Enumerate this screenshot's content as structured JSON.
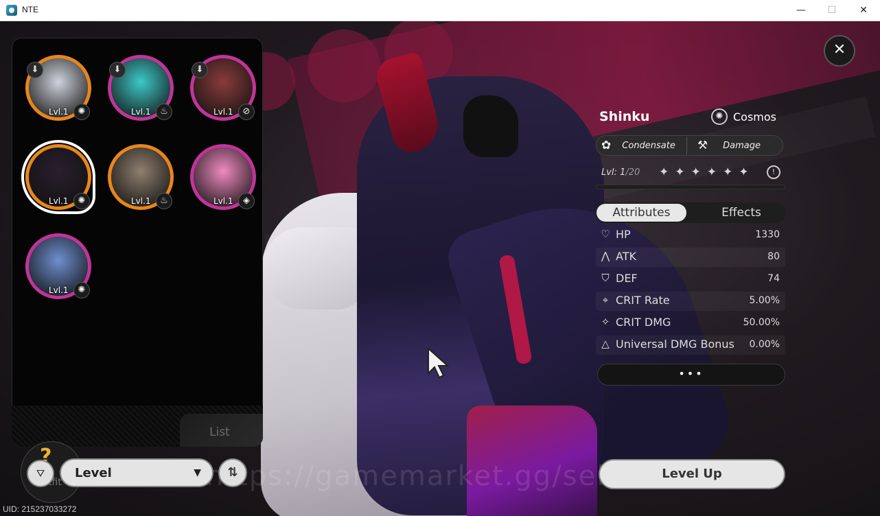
{
  "window": {
    "title": "NTE",
    "minimize_glyph": "—",
    "maximize_glyph": "☐",
    "close_glyph": "✕"
  },
  "watermark": "https://gamemarket.gg/seller/GameNe",
  "roster": {
    "tab_label": "List",
    "characters": [
      {
        "level": "Lvl.1",
        "ring_color": "#e8861c",
        "face_color": "#cfd3dc",
        "element_icon": "cosmos-icon",
        "element_glyph": "✺",
        "downloadable": true
      },
      {
        "level": "Lvl.1",
        "ring_color": "#c1349a",
        "face_color": "#3ec8c8",
        "element_icon": "anima-icon",
        "element_glyph": "♨",
        "downloadable": true
      },
      {
        "level": "Lvl.1",
        "ring_color": "#c1349a",
        "face_color": "#8a3b3b",
        "element_icon": "incantation-icon",
        "element_glyph": "⊘",
        "downloadable": true
      },
      {
        "level": "Lvl.1",
        "ring_color": "#e8861c",
        "face_color": "#2a1f2e",
        "element_icon": "cosmos-icon",
        "element_glyph": "✺",
        "downloadable": false,
        "selected": true
      },
      {
        "level": "Lvl.1",
        "ring_color": "#e8861c",
        "face_color": "#8f7f6e",
        "element_icon": "anima-icon",
        "element_glyph": "♨",
        "downloadable": false
      },
      {
        "level": "Lvl.1",
        "ring_color": "#c1349a",
        "face_color": "#f08ac0",
        "element_icon": "psyche-icon",
        "element_glyph": "◈",
        "downloadable": false
      },
      {
        "level": "Lvl.1",
        "ring_color": "#c1349a",
        "face_color": "#6f8fd0",
        "element_icon": "cosmos-icon",
        "element_glyph": "✺",
        "downloadable": false
      }
    ]
  },
  "close_button_glyph": "✕",
  "character": {
    "name": "Shinku",
    "faction": "Cosmos",
    "faction_glyph": "✺",
    "role_type": "Condensate",
    "role_type_glyph": "✿",
    "role_style": "Damage",
    "role_style_glyph": "⚒",
    "level_label": "Lvl: 1",
    "level_max": "/20",
    "stars": [
      "✦",
      "✦",
      "✦",
      "✦",
      "✦",
      "✦"
    ],
    "ascend_glyph": "!",
    "xp_progress": 0.0
  },
  "tabs": {
    "attributes": "Attributes",
    "effects": "Effects"
  },
  "stats": [
    {
      "icon": "heart-icon",
      "glyph": "♡",
      "label": "HP",
      "value": "1330"
    },
    {
      "icon": "atk-icon",
      "glyph": "⋀",
      "label": "ATK",
      "value": "80"
    },
    {
      "icon": "shield-icon",
      "glyph": "⛉",
      "label": "DEF",
      "value": "74"
    },
    {
      "icon": "crit-rate-icon",
      "glyph": "⌖",
      "label": "CRIT Rate",
      "value": "5.00%"
    },
    {
      "icon": "crit-dmg-icon",
      "glyph": "✧",
      "label": "CRIT DMG",
      "value": "50.00%"
    },
    {
      "icon": "triangle-icon",
      "glyph": "△",
      "label": "Universal DMG Bonus",
      "value": "0.00%"
    }
  ],
  "more_label": "•••",
  "level_up_label": "Level Up",
  "controls": {
    "outfit_label": "Outfit",
    "outfit_glyph": "?",
    "filter_glyph": "⛛",
    "sort_label": "Level",
    "sort_caret": "▼",
    "order_glyph": "⇅"
  },
  "uid": "UID: 215237033272"
}
